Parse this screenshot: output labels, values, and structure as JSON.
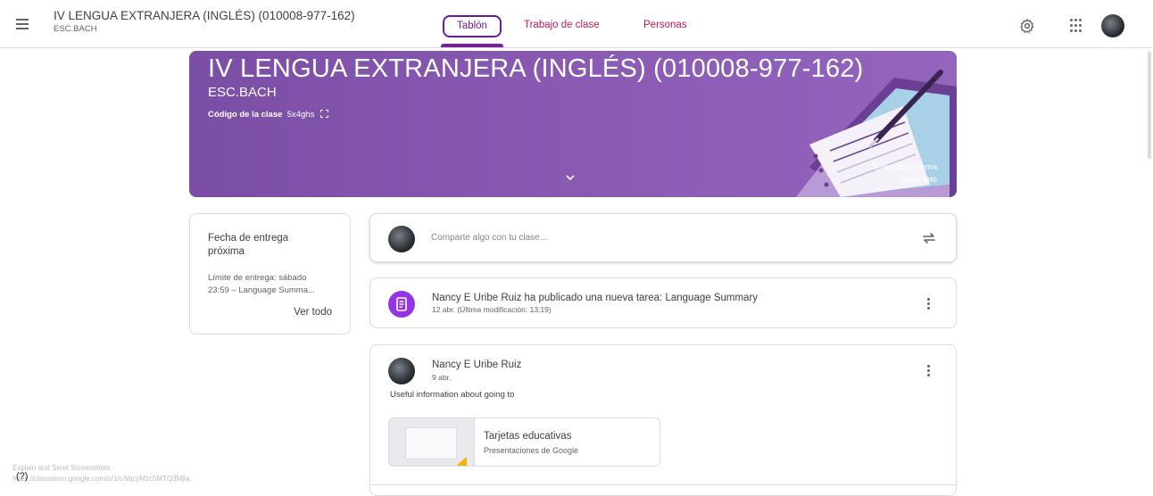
{
  "header": {
    "course_name": "IV LENGUA EXTRANJERA (INGLÉS) (010008-977-162)",
    "course_section": "ESC.BACH",
    "tabs": [
      {
        "label": "Tablón",
        "active": true
      },
      {
        "label": "Trabajo de clase",
        "active": false
      },
      {
        "label": "Personas",
        "active": false
      }
    ],
    "icons": [
      "menu-icon",
      "gear-icon",
      "apps-icon",
      "account-avatar"
    ],
    "accent_color": "#7b1fa2",
    "tab_color": "#c2185b"
  },
  "banner": {
    "title": "IV LENGUA EXTRANJERA (INGLÉS) (010008-977-162)",
    "section": "ESC.BACH",
    "code_label": "Código de la clase",
    "code_value": "5x4ghs",
    "select_theme": "Seleccionar tema",
    "upload_photo": "Subir foto",
    "color": "#8358ad"
  },
  "upcoming": {
    "title": "Fecha de entrega próxima",
    "due_line1": "Límite de entrega: sábado",
    "due_line2": "23:59 – Language Summa...",
    "view_all": "Ver todo"
  },
  "share": {
    "placeholder": "Comparte algo con tu clase..."
  },
  "assignment": {
    "title": "Nancy E Uribe Ruiz ha publicado una nueva tarea: Language Summary",
    "meta": "12 abr. (Última modificación: 13:19)",
    "icon_color": "#9334e6"
  },
  "post": {
    "author": "Nancy E Uribe Ruiz",
    "date": "9 abr.",
    "text": "Useful information about going to",
    "attachment": {
      "name": "Tarjetas educativas",
      "type": "Presentaciones de Google"
    }
  },
  "footer": {
    "help_symbol": "(?)",
    "overlay_line1": "Explain and Send Screenshots",
    "overlay_line2": "https://classroom.google.com/u/1/c/MjcyMzc5MTQ3Mjla"
  }
}
